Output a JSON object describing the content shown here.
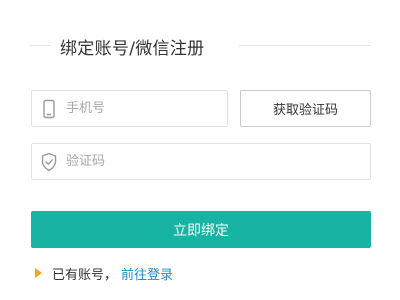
{
  "header": {
    "title": "绑定账号/微信注册"
  },
  "form": {
    "phone_placeholder": "手机号",
    "get_code_label": "获取验证码",
    "code_placeholder": "验证码",
    "submit_label": "立即绑定"
  },
  "footer": {
    "have_account_text": "已有账号，",
    "login_link_label": "前往登录"
  },
  "icons": {
    "phone": "phone-icon",
    "shield": "shield-check-icon",
    "arrow": "triangle-right-icon"
  },
  "colors": {
    "primary": "#17b3a3",
    "link": "#1a8fd6",
    "arrow": "#f2a71a",
    "border": "#e2e2e2",
    "placeholder": "#a8a8a8"
  }
}
